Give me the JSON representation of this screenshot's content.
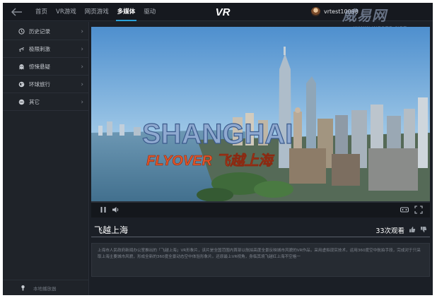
{
  "nav": {
    "items": [
      "首页",
      "VR游戏",
      "网页游戏",
      "多媒体",
      "驱动"
    ],
    "active_index": 3
  },
  "logo": {
    "text": "VR"
  },
  "user": {
    "name": "vrtest10088"
  },
  "watermark": {
    "main": "威易网",
    "sub": "WWW.WESTE.NET"
  },
  "sidebar": {
    "items": [
      {
        "label": "历史记录",
        "icon": "history-icon"
      },
      {
        "label": "极限刺激",
        "icon": "skateboard-icon"
      },
      {
        "label": "惊悚悬疑",
        "icon": "ghost-icon"
      },
      {
        "label": "环球旅行",
        "icon": "globe-icon"
      },
      {
        "label": "其它",
        "icon": "more-icon"
      }
    ],
    "footer_label": "本地播放器"
  },
  "video": {
    "overlay_title": "SHANGHAI",
    "overlay_subtitle": "FLYOVER 飞越上海",
    "progress": 0.0
  },
  "details": {
    "title": "飞越上海",
    "views": "33次观看",
    "description": "上海市人民政府新闻办公室推出的「飞越上海」VR形象片，该片是全国范围内首部以航拍高度全景反映城市风貌的VR作品，采用虚拟现实技术，运用360度空中航拍手段，完成对于只采取上海主要城市风貌，形成全新的360度全景动态空中体验形象片。还原最上VR视角，身临其境飞越红上海不空格一"
  },
  "colors": {
    "accent": "#2aa0d8",
    "background": "#1b1f26",
    "panel": "#262b32"
  }
}
